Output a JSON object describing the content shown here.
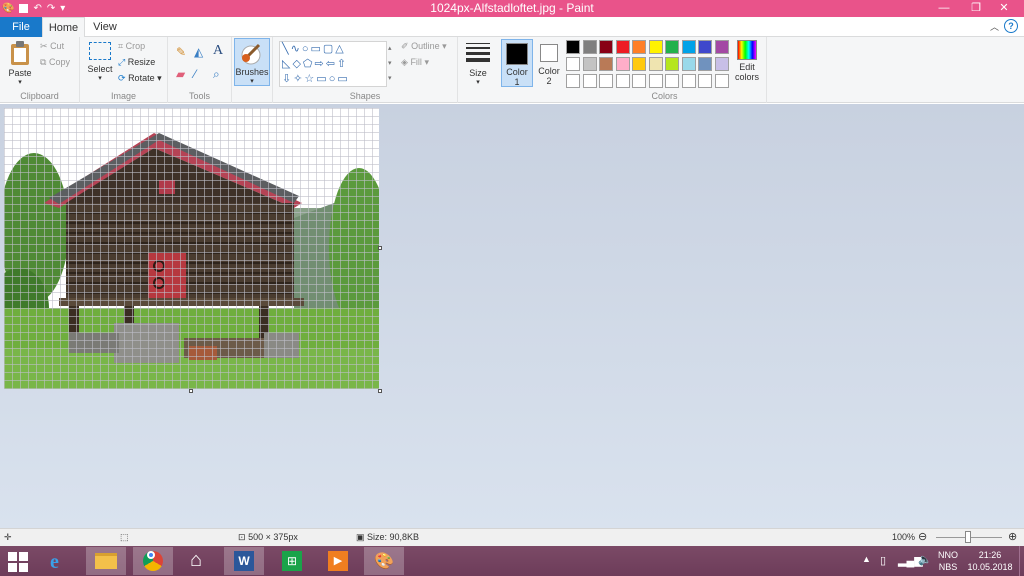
{
  "window": {
    "title": "1024px-Alfstadloftet.jpg - Paint",
    "minimize_glyph": "—",
    "maximize_glyph": "❐",
    "close_glyph": "✕"
  },
  "tabs": [
    {
      "label": "File"
    },
    {
      "label": "Home"
    },
    {
      "label": "View"
    }
  ],
  "ribbon": {
    "clipboard": {
      "label": "Clipboard",
      "paste": "Paste",
      "cut": "Cut",
      "copy": "Copy"
    },
    "image": {
      "label": "Image",
      "select": "Select",
      "crop": "Crop",
      "resize": "Resize",
      "rotate": "Rotate"
    },
    "tools": {
      "label": "Tools"
    },
    "brushes": {
      "label": "Brushes"
    },
    "shapes": {
      "label": "Shapes",
      "outline": "Outline",
      "fill": "Fill"
    },
    "size": {
      "label": "Size"
    },
    "color1": {
      "label": "Color",
      "num": "1"
    },
    "color2": {
      "label": "Color",
      "num": "2"
    },
    "colors": {
      "label": "Colors",
      "edit_line1": "Edit",
      "edit_line2": "colors",
      "row1": [
        "#000000",
        "#7f7f7f",
        "#880015",
        "#ed1c24",
        "#ff7f27",
        "#fff200",
        "#22b14c",
        "#00a2e8",
        "#3f48cc",
        "#a349a4"
      ],
      "row2": [
        "#ffffff",
        "#c3c3c3",
        "#b97a57",
        "#ffaec9",
        "#ffc90e",
        "#efe4b0",
        "#b5e61d",
        "#99d9ea",
        "#7092be",
        "#c8bfe7"
      ],
      "row3": [
        "#ffffff",
        "#ffffff",
        "#ffffff",
        "#ffffff",
        "#ffffff",
        "#ffffff",
        "#ffffff",
        "#ffffff",
        "#ffffff",
        "#ffffff"
      ]
    }
  },
  "status": {
    "dimensions": "500 × 375px",
    "size": "Size: 90,8KB",
    "zoom": "100%"
  },
  "taskbar": {
    "lang1": "NNO",
    "lang2": "NBS",
    "time": "21:26",
    "date": "10.05.2018"
  }
}
